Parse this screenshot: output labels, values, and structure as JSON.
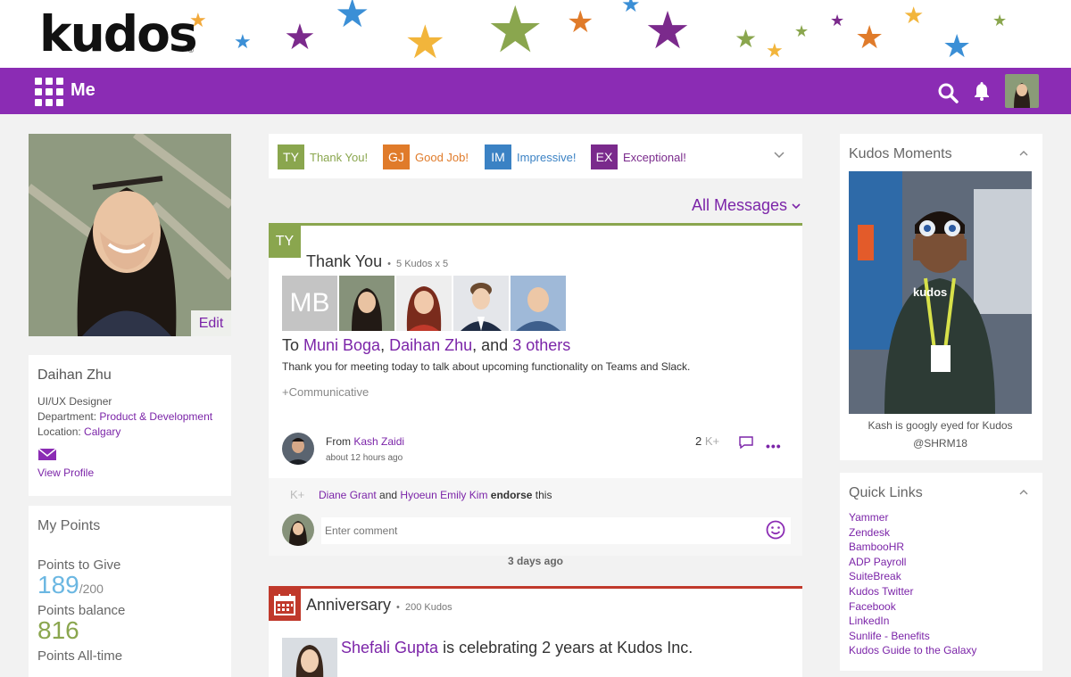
{
  "app": {
    "logo": "kudos",
    "nav_title": "Me"
  },
  "colors": {
    "brand": "#8b2cb4",
    "link": "#7b24a8",
    "ty": "#8aa64e",
    "gj": "#e07b2a",
    "im": "#3b82c4",
    "ex": "#7a2a8c",
    "anniversary": "#c0392b"
  },
  "icons": [
    "grid-icon",
    "search-icon",
    "bell-icon",
    "mail-icon",
    "chevron-down-icon",
    "chevron-up-icon",
    "comment-icon",
    "more-icon",
    "smiley-icon",
    "calendar-icon"
  ],
  "profile": {
    "edit_label": "Edit",
    "name": "Daihan Zhu",
    "title": "UI/UX Designer",
    "department_label": "Department:",
    "department": "Product & Development",
    "location_label": "Location:",
    "location": "Calgary",
    "view_profile": "View Profile"
  },
  "points": {
    "title": "My Points",
    "to_give_label": "Points to Give",
    "to_give": "189",
    "to_give_total": "/200",
    "balance_label": "Points balance",
    "balance": "816",
    "alltime_label": "Points All-time"
  },
  "filters": [
    {
      "code": "TY",
      "label": "Thank You!"
    },
    {
      "code": "GJ",
      "label": "Good Job!"
    },
    {
      "code": "IM",
      "label": "Impressive!"
    },
    {
      "code": "EX",
      "label": "Exceptional!"
    }
  ],
  "feed": {
    "all_messages": "All Messages",
    "days_ago": "3 days ago"
  },
  "post": {
    "badge": "TY",
    "title": "Thank You",
    "meta": "5 Kudos x 5",
    "initials": "MB",
    "to_prefix": "To ",
    "recipient1": "Muni Boga",
    "recipient2": "Daihan Zhu",
    "and_text": ", and ",
    "others": "3 others",
    "message": "Thank you for meeting today to talk about upcoming functionality on Teams and Slack.",
    "tag": "+Communicative",
    "from_label": "From ",
    "from_name": "Kash Zaidi",
    "time": "about 12 hours ago",
    "kudos_count": "2",
    "kplus": "K+",
    "endorse_k": "K+",
    "endorser1": "Diane Grant",
    "endorse_and": " and ",
    "endorser2": "Hyoeun Emily Kim",
    "endorse_verb": " endorse",
    "endorse_this": " this",
    "comment_placeholder": "Enter comment"
  },
  "anniversary": {
    "title": "Anniversary",
    "meta": "200 Kudos",
    "person": "Shefali Gupta",
    "text": " is celebrating 2 years at Kudos Inc."
  },
  "moments": {
    "title": "Kudos Moments",
    "caption_line1": "Kash is googly eyed for Kudos",
    "caption_line2": "@SHRM18",
    "badge_brand": "kudos"
  },
  "quick_links": {
    "title": "Quick Links",
    "items": [
      "Yammer",
      "Zendesk",
      "BambooHR",
      "ADP Payroll",
      "SuiteBreak",
      "Kudos Twitter",
      "Facebook",
      "LinkedIn",
      "Sunlife - Benefits",
      "Kudos Guide to the Galaxy"
    ]
  }
}
